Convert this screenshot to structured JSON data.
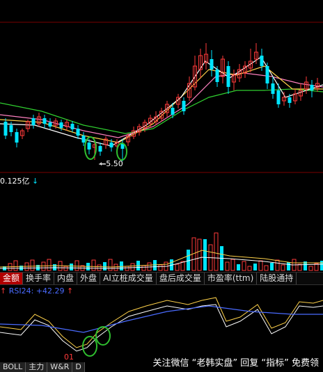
{
  "colors": {
    "up": "#ff3a3a",
    "down": "#00e5ff",
    "ma_white": "#ffffff",
    "ma_yellow": "#ffd24a",
    "ma_pink": "#ff80c0",
    "ma_green": "#30d030",
    "tab_active_bg": "#b10000",
    "marker": "#2fbf2f"
  },
  "price_chart": {
    "low_label": "5.50",
    "low_arrow": "←"
  },
  "volume_panel": {
    "label": "0.125亿",
    "arrow": "↓"
  },
  "indicator_tabs": [
    {
      "label": "金额",
      "active": true
    },
    {
      "label": "换手率",
      "active": false
    },
    {
      "label": "内盘",
      "active": false
    },
    {
      "label": "外盘",
      "active": false
    },
    {
      "label": "AI立桩成交量",
      "active": false
    },
    {
      "label": "盘后成交量",
      "active": false
    },
    {
      "label": "市盈率(ttm)",
      "active": false
    },
    {
      "label": "陆股通持",
      "active": false
    }
  ],
  "rsi_panel": {
    "up_arrow_left": "↑",
    "label": "RSI24: +42.29",
    "up_arrow_right": "↑",
    "bottom_value": "01"
  },
  "bottom_tabs": [
    "BOLL",
    "主力",
    "W&R",
    "D"
  ],
  "watermark": "关注微信 “老韩实盘” 回复 “指标” 免费领"
}
